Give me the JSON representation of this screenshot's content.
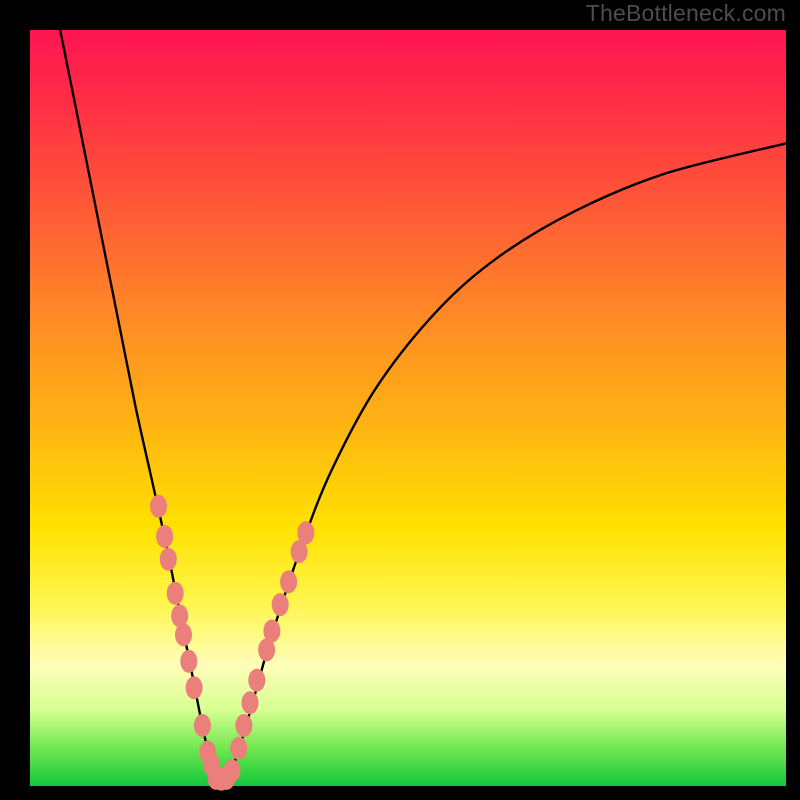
{
  "watermark": "TheBottleneck.com",
  "chart_data": {
    "type": "line",
    "title": "",
    "xlabel": "",
    "ylabel": "",
    "xlim": [
      0,
      100
    ],
    "ylim": [
      0,
      100
    ],
    "grid": false,
    "legend": false,
    "series": [
      {
        "name": "bottleneck-curve",
        "color": "#000000",
        "x": [
          4,
          6,
          8,
          10,
          12,
          14,
          16,
          18,
          20,
          21,
          22,
          23,
          24,
          25,
          26,
          27,
          28,
          30,
          32,
          36,
          40,
          46,
          54,
          62,
          72,
          84,
          100
        ],
        "y": [
          100,
          90,
          80,
          70,
          60,
          50,
          41,
          32,
          22,
          17,
          12,
          7,
          3,
          1,
          1,
          3,
          6,
          13,
          20,
          32,
          42,
          53,
          63,
          70,
          76,
          81,
          85
        ]
      }
    ],
    "markers": [
      {
        "name": "left-cluster",
        "color": "#ea7f7b",
        "shape": "ellipse",
        "points": [
          {
            "x": 17.0,
            "y": 37.0
          },
          {
            "x": 17.8,
            "y": 33.0
          },
          {
            "x": 18.3,
            "y": 30.0
          },
          {
            "x": 19.2,
            "y": 25.5
          },
          {
            "x": 19.8,
            "y": 22.5
          },
          {
            "x": 20.3,
            "y": 20.0
          },
          {
            "x": 21.0,
            "y": 16.5
          },
          {
            "x": 21.7,
            "y": 13.0
          },
          {
            "x": 22.8,
            "y": 8.0
          },
          {
            "x": 23.5,
            "y": 4.5
          },
          {
            "x": 24.0,
            "y": 2.8
          }
        ]
      },
      {
        "name": "bottom-cluster",
        "color": "#ea7f7b",
        "shape": "ellipse",
        "points": [
          {
            "x": 24.6,
            "y": 1.0
          },
          {
            "x": 25.3,
            "y": 0.9
          },
          {
            "x": 26.0,
            "y": 1.0
          },
          {
            "x": 26.7,
            "y": 2.0
          }
        ]
      },
      {
        "name": "right-cluster",
        "color": "#ea7f7b",
        "shape": "ellipse",
        "points": [
          {
            "x": 27.6,
            "y": 5.0
          },
          {
            "x": 28.3,
            "y": 8.0
          },
          {
            "x": 29.1,
            "y": 11.0
          },
          {
            "x": 30.0,
            "y": 14.0
          },
          {
            "x": 31.3,
            "y": 18.0
          },
          {
            "x": 32.0,
            "y": 20.5
          },
          {
            "x": 33.1,
            "y": 24.0
          },
          {
            "x": 34.2,
            "y": 27.0
          },
          {
            "x": 35.6,
            "y": 31.0
          },
          {
            "x": 36.5,
            "y": 33.5
          }
        ]
      }
    ],
    "background_gradient": {
      "direction": "vertical",
      "stops": [
        {
          "pos": 0.0,
          "color": "#ff1452"
        },
        {
          "pos": 0.1,
          "color": "#ff2f45"
        },
        {
          "pos": 0.25,
          "color": "#ff5e35"
        },
        {
          "pos": 0.38,
          "color": "#ff8a25"
        },
        {
          "pos": 0.52,
          "color": "#ffb313"
        },
        {
          "pos": 0.66,
          "color": "#ffe200"
        },
        {
          "pos": 0.76,
          "color": "#fff650"
        },
        {
          "pos": 0.84,
          "color": "#fffeb9"
        },
        {
          "pos": 0.9,
          "color": "#d7ff90"
        },
        {
          "pos": 0.95,
          "color": "#70e850"
        },
        {
          "pos": 1.0,
          "color": "#14c63a"
        }
      ]
    }
  }
}
